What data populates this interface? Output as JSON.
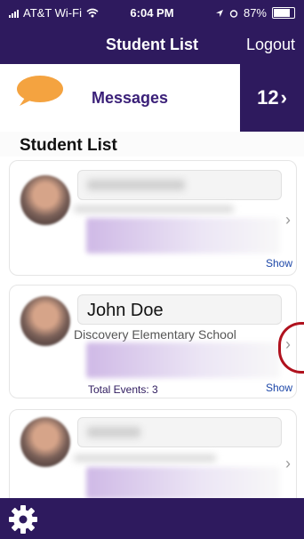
{
  "status_bar": {
    "carrier": "AT&T Wi-Fi",
    "time": "6:04 PM",
    "battery": "87%",
    "battery_level": 0.87
  },
  "nav": {
    "title": "Student List",
    "logout": "Logout"
  },
  "messages": {
    "label": "Messages",
    "count": "12",
    "chevron": "›"
  },
  "section": {
    "title": "Student List"
  },
  "students": [
    {
      "name": "",
      "school": "",
      "total_events": "",
      "show_label": "Show",
      "chevron": "›"
    },
    {
      "name": "John Doe",
      "school": "Discovery Elementary School",
      "total_events": "Total Events: 3",
      "show_label": "Show",
      "chevron": "›"
    },
    {
      "name": "",
      "school": "",
      "total_events": "",
      "show_label": "",
      "chevron": "›"
    }
  ],
  "colors": {
    "primary": "#2e1a5e",
    "accent_text": "#3a1f78",
    "link": "#1d47a8",
    "annotation_red": "#b0121e",
    "bubble": "#f4a340"
  },
  "icons": {
    "messages": "speech-bubble-icon",
    "settings": "gear-icon",
    "wifi": "wifi-icon",
    "location": "location-icon",
    "alarm": "alarm-icon"
  }
}
